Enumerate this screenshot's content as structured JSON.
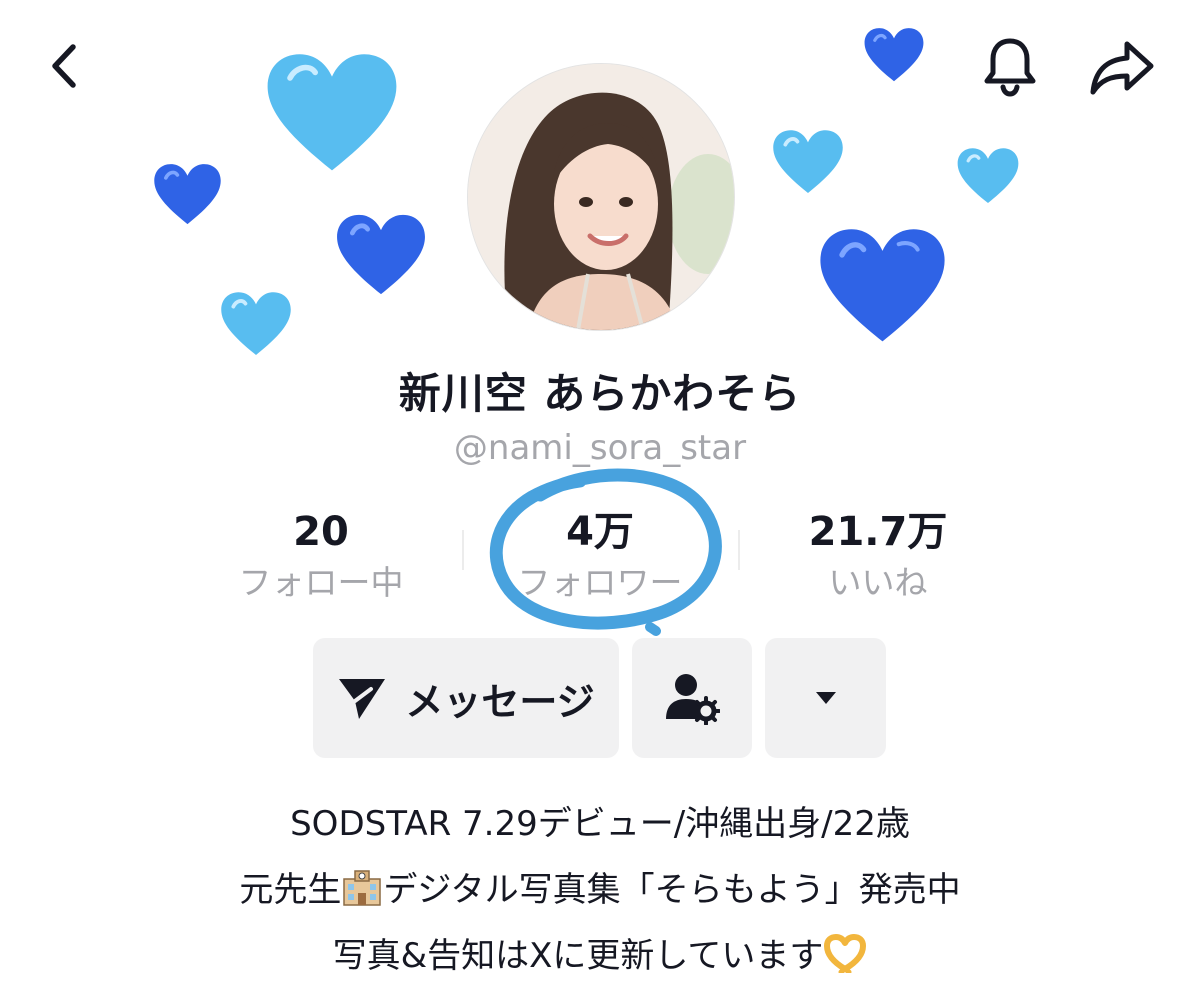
{
  "header": {
    "back_icon": "chevron-left-icon",
    "bell_icon": "bell-icon",
    "share_icon": "share-arrow-icon"
  },
  "profile": {
    "display_name": "新川空 あらかわそら",
    "handle": "@nami_sora_star"
  },
  "stats": [
    {
      "value": "20",
      "label": "フォロー中"
    },
    {
      "value": "4万",
      "label": "フォロワー"
    },
    {
      "value": "21.7万",
      "label": "いいね"
    }
  ],
  "actions": {
    "message_label": "メッセージ",
    "message_icon": "send-icon",
    "follow_settings_icon": "user-settings-icon",
    "more_icon": "caret-down-icon"
  },
  "bio": {
    "line1": "SODSTAR 7.29デビュー/沖縄出身/22歳",
    "line2_part1": "元先生",
    "line2_emoji": "school-emoji",
    "line2_part2": "デジタル写真集「そらもよう」発売中",
    "line3_text": "写真&告知はXに更新しています",
    "line3_emoji": "heart-hands-emoji"
  },
  "colors": {
    "light_heart": "#58bdf0",
    "dark_heart": "#2f63e6",
    "circle_annotation": "#48a2de",
    "button_bg": "#f1f1f2",
    "muted_text": "#a5a6ab"
  }
}
